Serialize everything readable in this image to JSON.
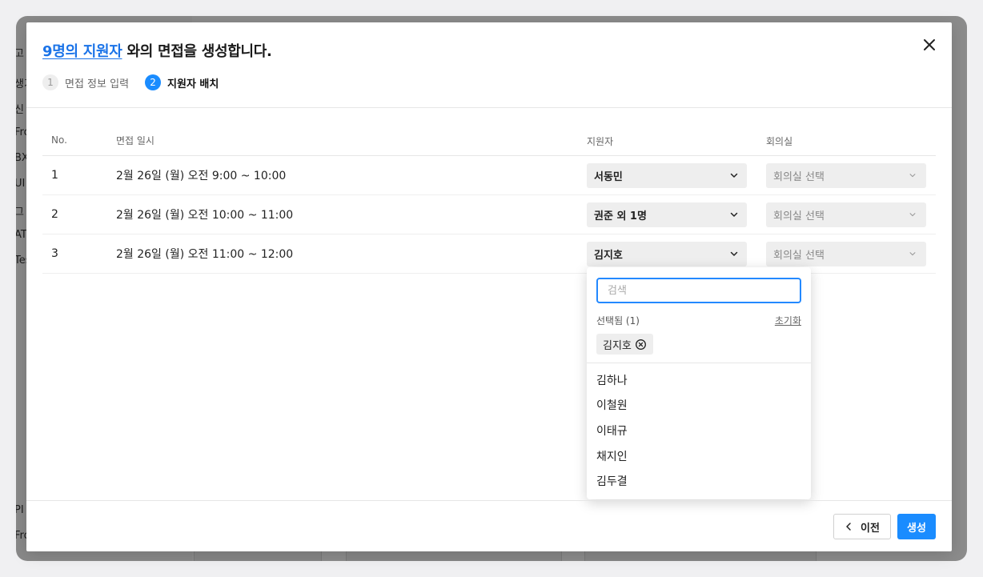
{
  "modal": {
    "title_link": "9명의 지원자",
    "title_rest": " 와의 면접을 생성합니다.",
    "steps": [
      {
        "num": "1",
        "label": "면접 정보 입력"
      },
      {
        "num": "2",
        "label": "지원자 배치"
      }
    ],
    "active_step": 2,
    "close_icon": "close-icon"
  },
  "table": {
    "headers": {
      "no": "No.",
      "datetime": "면접 일시",
      "applicant": "지원자",
      "room": "회의실"
    },
    "rows": [
      {
        "no": "1",
        "datetime": "2월 26일 (월) 오전 9:00 ~ 10:00",
        "applicant": "서동민",
        "room": "회의실 선택"
      },
      {
        "no": "2",
        "datetime": "2월 26일 (월) 오전 10:00 ~ 11:00",
        "applicant": "권준 외 1명",
        "room": "회의실 선택"
      },
      {
        "no": "3",
        "datetime": "2월 26일 (월) 오전 11:00 ~ 12:00",
        "applicant": "김지호",
        "room": "회의실 선택"
      }
    ]
  },
  "dropdown": {
    "search_placeholder": "검색",
    "search_value": "",
    "selected_label": "선택됨 (1)",
    "reset_label": "초기화",
    "selected_chips": [
      "김지호"
    ],
    "options": [
      "김하나",
      "이철원",
      "이태규",
      "채지인",
      "김두결"
    ]
  },
  "footer": {
    "prev_label": "이전",
    "create_label": "생성"
  },
  "background": {
    "sidebar_fragments": [
      "고",
      "생기",
      "신",
      "Fro",
      "BX",
      "UI I",
      "그",
      "AT",
      "Tes",
      "PI",
      "Fro"
    ]
  },
  "colors": {
    "accent": "#1a8cff",
    "link": "#1a73e8",
    "dim_overlay": "rgba(0,0,0,0.45)"
  }
}
